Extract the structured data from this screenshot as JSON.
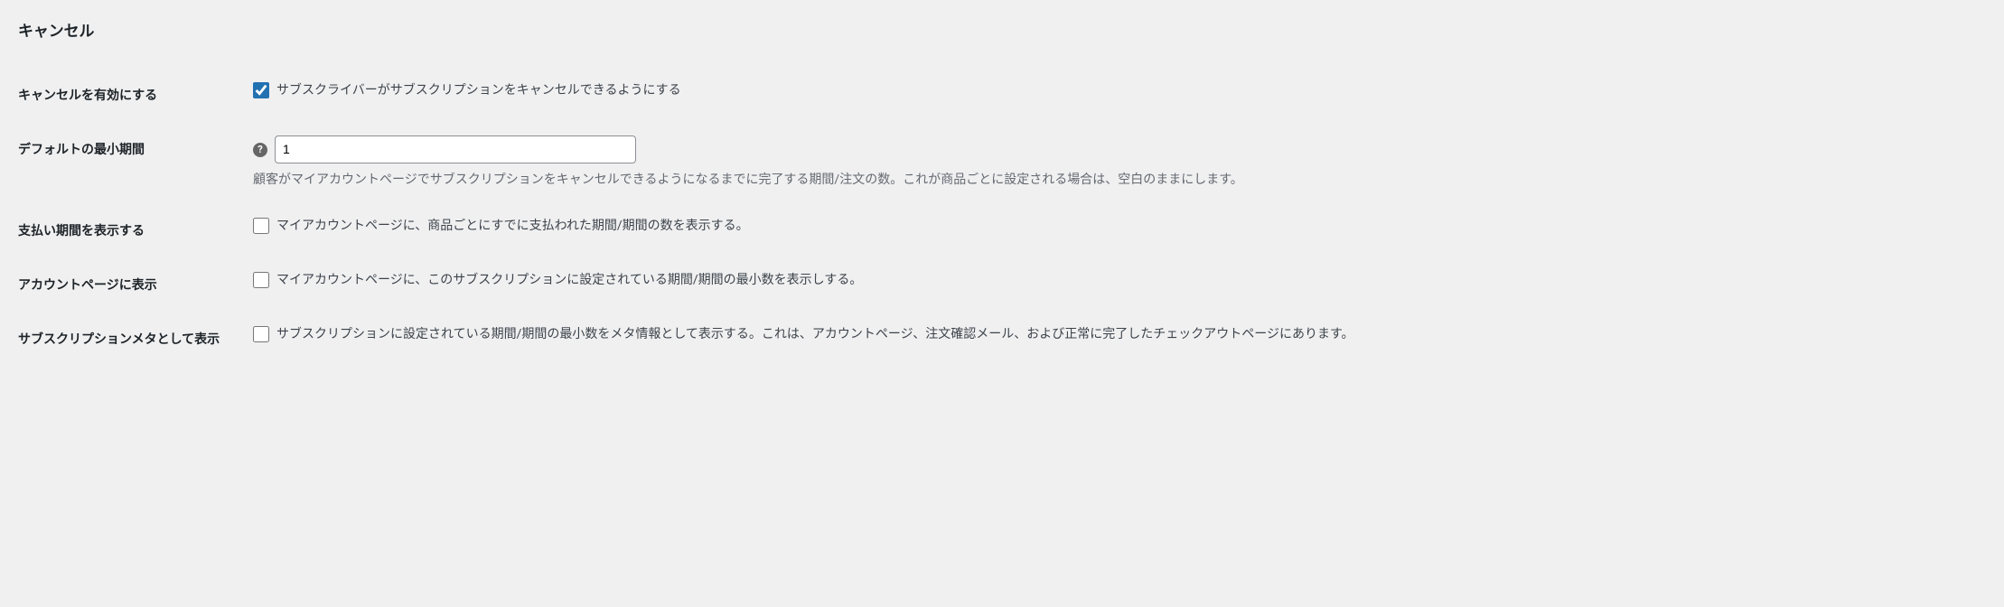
{
  "section": {
    "title": "キャンセル"
  },
  "enableCancel": {
    "label": "キャンセルを有効にする",
    "checked": true,
    "description": "サブスクライバーがサブスクリプションをキャンセルできるようにする"
  },
  "defaultMinPeriod": {
    "label": "デフォルトの最小期間",
    "value": "1",
    "description": "顧客がマイアカウントページでサブスクリプションをキャンセルできるようになるまでに完了する期間/注文の数。これが商品ごとに設定される場合は、空白のままにします。"
  },
  "displayPaidPeriods": {
    "label": "支払い期間を表示する",
    "checked": false,
    "description": "マイアカウントページに、商品ごとにすでに支払われた期間/期間の数を表示する。"
  },
  "displayOnAccountPage": {
    "label": "アカウントページに表示",
    "checked": false,
    "description": "マイアカウントページに、このサブスクリプションに設定されている期間/期間の最小数を表示しする。"
  },
  "displayAsMeta": {
    "label": "サブスクリプションメタとして表示",
    "checked": false,
    "description": "サブスクリプションに設定されている期間/期間の最小数をメタ情報として表示する。これは、アカウントページ、注文確認メール、および正常に完了したチェックアウトページにあります。"
  }
}
